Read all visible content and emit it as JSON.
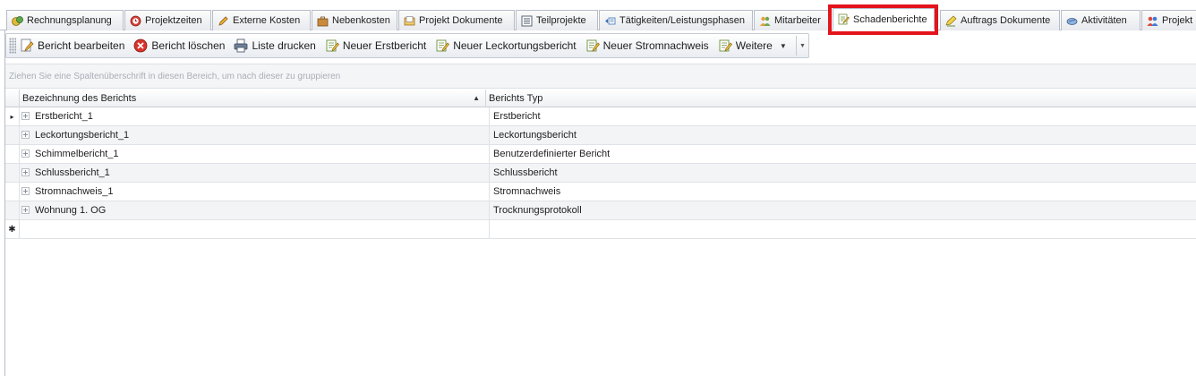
{
  "tabs": [
    {
      "label": "Rechnungsplanung",
      "icon": "money-icon"
    },
    {
      "label": "Projektzeiten",
      "icon": "clock-icon"
    },
    {
      "label": "Externe Kosten",
      "icon": "pencil-icon"
    },
    {
      "label": "Nebenkosten",
      "icon": "briefcase-icon"
    },
    {
      "label": "Projekt Dokumente",
      "icon": "document-folder-icon"
    },
    {
      "label": "Teilprojekte",
      "icon": "list-icon"
    },
    {
      "label": "Tätigkeiten/Leistungsphasen",
      "icon": "phases-icon"
    },
    {
      "label": "Mitarbeiter",
      "icon": "users-icon"
    },
    {
      "label": "Schadenberichte",
      "icon": "report-edit-icon",
      "active": true
    },
    {
      "label": "Auftrags Dokumente",
      "icon": "document-edit-icon"
    },
    {
      "label": "Aktivitäten",
      "icon": "activity-icon"
    },
    {
      "label": "Projekt",
      "icon": "team-icon"
    }
  ],
  "toolbar": {
    "edit_label": "Bericht bearbeiten",
    "delete_label": "Bericht löschen",
    "print_label": "Liste drucken",
    "new_first_label": "Neuer Erstbericht",
    "new_leak_label": "Neuer Leckortungsbericht",
    "new_power_label": "Neuer Stromnachweis",
    "more_label": "Weitere"
  },
  "group_panel": {
    "hint": "Ziehen Sie eine Spaltenüberschrift in diesen Bereich, um nach dieser zu gruppieren"
  },
  "grid": {
    "columns": [
      "Bezeichnung des Berichts",
      "Berichts Typ"
    ],
    "rows": [
      {
        "name": "Erstbericht_1",
        "type": "Erstbericht"
      },
      {
        "name": "Leckortungsbericht_1",
        "type": "Leckortungsbericht"
      },
      {
        "name": "Schimmelbericht_1",
        "type": "Benutzerdefinierter Bericht"
      },
      {
        "name": "Schlussbericht_1",
        "type": "Schlussbericht"
      },
      {
        "name": "Stromnachweis_1",
        "type": "Stromnachweis"
      },
      {
        "name": "Wohnung 1. OG",
        "type": "Trocknungsprotokoll"
      }
    ],
    "current_row_marker": "▸",
    "new_row_marker": "✱"
  },
  "colors": {
    "highlight": "#e3141b",
    "border": "#b6bcc6"
  }
}
